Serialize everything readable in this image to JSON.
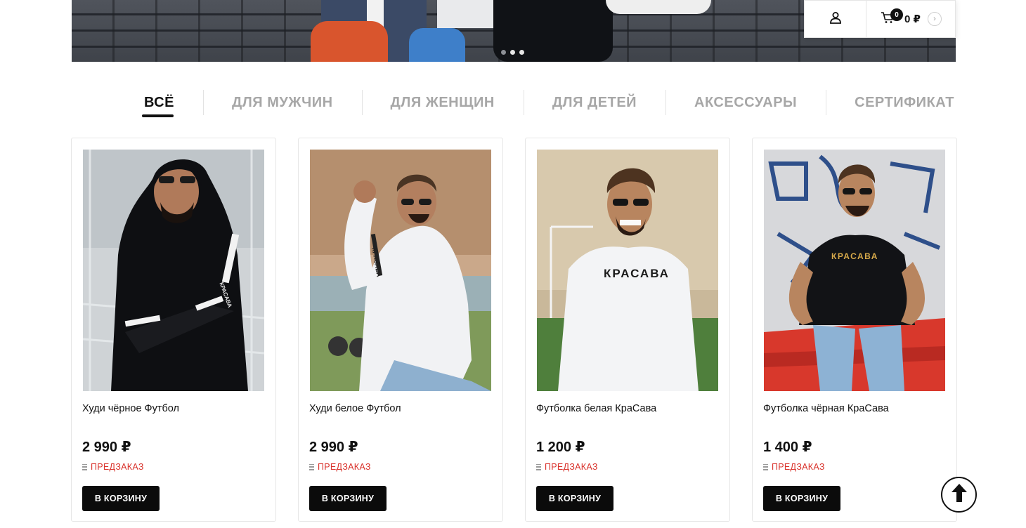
{
  "header": {
    "cart_count": "0",
    "cart_sum": "0 ₽",
    "user_icon": "user-icon",
    "cart_icon": "cart-icon",
    "arrow_glyph": "›"
  },
  "slider": {
    "dots": 3,
    "active_dot": 1
  },
  "tabs": [
    {
      "label": "ВСЁ",
      "active": true
    },
    {
      "label": "ДЛЯ МУЖЧИН",
      "active": false
    },
    {
      "label": "ДЛЯ ЖЕНЩИН",
      "active": false
    },
    {
      "label": "ДЛЯ ДЕТЕЙ",
      "active": false
    },
    {
      "label": "АКСЕССУАРЫ",
      "active": false
    },
    {
      "label": "СЕРТИФИКАТ",
      "active": false
    }
  ],
  "products": [
    {
      "name": "Худи чёрное Футбол",
      "price": "2 990 ₽",
      "status": "ПРЕДЗАКАЗ",
      "button": "В КОРЗИНУ"
    },
    {
      "name": "Худи белое Футбол",
      "price": "2 990 ₽",
      "status": "ПРЕДЗАКАЗ",
      "button": "В КОРЗИНУ"
    },
    {
      "name": "Футболка белая КраСава",
      "price": "1 200 ₽",
      "status": "ПРЕДЗАКАЗ",
      "button": "В КОРЗИНУ"
    },
    {
      "name": "Футболка чёрная КраСава",
      "price": "1 400 ₽",
      "status": "ПРЕДЗАКАЗ",
      "button": "В КОРЗИНУ"
    }
  ],
  "photo_texts": [
    "КРАСАВА",
    "КРАСАВА",
    "КРАСАВА",
    "КРАСАВА"
  ],
  "colors": {
    "accent": "#d9322b",
    "button": "#0b0b0b",
    "muted_tab": "#a7a7a7"
  },
  "scroll_top_icon": "arrow-up-icon"
}
